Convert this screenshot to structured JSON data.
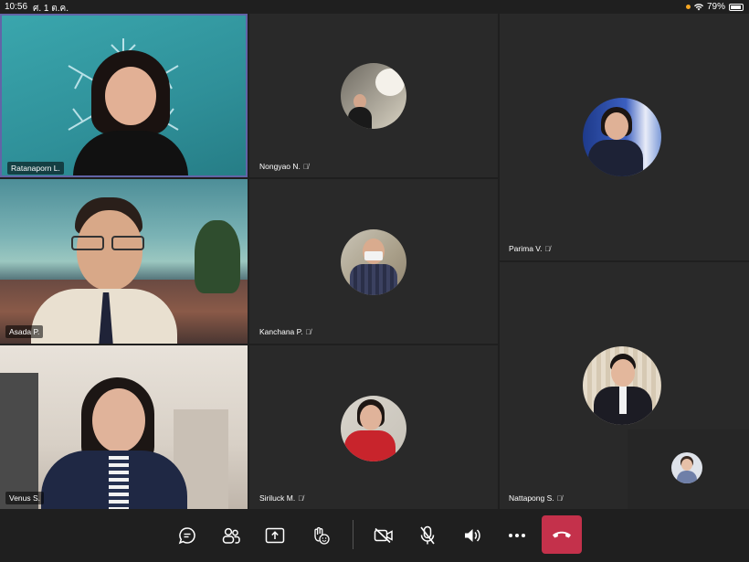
{
  "status": {
    "time": "10:56",
    "date": "ศ. 1 ต.ค.",
    "battery": "79%"
  },
  "participants": [
    {
      "name": "Ratanaporn L.",
      "muted": false
    },
    {
      "name": "Asada P.",
      "muted": false
    },
    {
      "name": "Venus S.",
      "muted": false
    },
    {
      "name": "Nongyao N.",
      "muted": true
    },
    {
      "name": "Kanchana P.",
      "muted": true
    },
    {
      "name": "Siriluck M.",
      "muted": true
    },
    {
      "name": "Parima V.",
      "muted": true
    },
    {
      "name": "Nattapong S.",
      "muted": true
    }
  ],
  "colors": {
    "background": "#1f1f1f",
    "tile": "#292929",
    "active_border": "#6264a7",
    "hangup": "#c4314b"
  },
  "toolbar": {
    "icons": [
      "chat-icon",
      "participants-icon",
      "share-screen-icon",
      "raise-hand-icon",
      "camera-off-icon",
      "mic-off-icon",
      "speaker-icon",
      "more-icon",
      "hang-up-icon"
    ]
  }
}
